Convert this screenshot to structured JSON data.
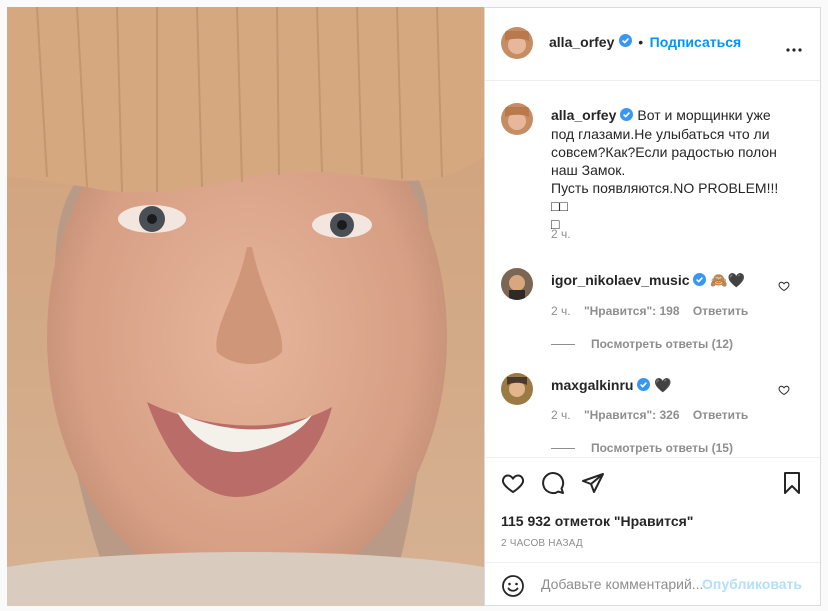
{
  "post": {
    "username": "alla_orfey",
    "separator": "•",
    "follow_label": "Подписаться",
    "more_icon": "more-dots-icon"
  },
  "caption": {
    "username": "alla_orfey",
    "text": "Вот и морщинки уже под глазами.Не улыбаться что ли совсем?Как?Если радостью полон наш Замок.\nПусть появляются.NO PROBLEM!!!□□\n□",
    "time": "2 ч."
  },
  "comments": [
    {
      "username": "igor_nikolaev_music",
      "text": "🙈🖤",
      "time": "2 ч.",
      "likes": "\"Нравится\": 198",
      "reply_label": "Ответить",
      "view_replies": "Посмотреть ответы (12)"
    },
    {
      "username": "maxgalkinru",
      "text": "🖤",
      "time": "2 ч.",
      "likes": "\"Нравится\": 326",
      "reply_label": "Ответить",
      "view_replies": "Посмотреть ответы (15)"
    }
  ],
  "actions": {
    "likes_count": "115 932 отметок \"Нравится\"",
    "timestamp": "2 ЧАСОВ НАЗАД",
    "comment_placeholder": "Добавьте комментарий...",
    "publish_label": "Опубликовать"
  },
  "colors": {
    "accent": "#0095f6",
    "verified": "#3897f0",
    "publish_disabled": "#b2dffc"
  }
}
